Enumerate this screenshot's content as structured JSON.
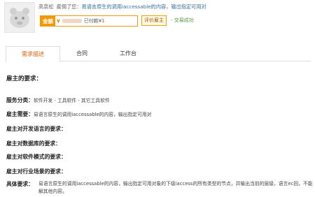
{
  "header": {
    "user": "高泉松",
    "action": "雇佣了您：",
    "task_title": "易语言原生的调用iaccessable的内容，输出指定可用对",
    "amount_label": "金额",
    "amount_value": "¥",
    "paid_label": "已付款¥",
    "paid_value": "1",
    "rate_button": "评价雇主",
    "status": "- 交易成功"
  },
  "tabs": [
    {
      "label": "需求描述"
    },
    {
      "label": "合同"
    },
    {
      "label": "工作台"
    }
  ],
  "requirements": {
    "title": "雇主的要求：",
    "service_label": "服务分类：",
    "service_value": "软件开发 - 工具软件 - 其它工具软件",
    "needs_label": "雇主需要：",
    "needs_value": "易语言原生的调用iaccessable的内容，输出指定可用对",
    "lang_label": "雇主对开发语言的要求：",
    "db_label": "雇主对数据库的要求：",
    "mode_label": "雇主对软件模式的要求：",
    "industry_label": "雇主对行业场景的要求：",
    "detail_label": "具体要求：",
    "detail_value": "易语言原生的调用iaccessable的内容，输出指定可用对象的下级iaccess的所有类型的节点，并输出当前的层级，语言ec回，不能解其他内容。"
  }
}
